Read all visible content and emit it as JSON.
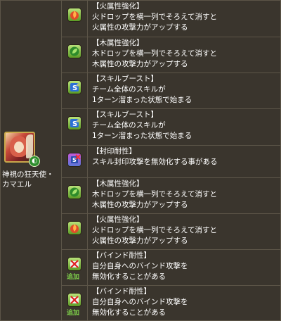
{
  "character": {
    "name_line1": "神視の狂天使・",
    "name_line2": "カマエル",
    "attribute_badge": "wood-attribute-icon"
  },
  "awakenings": [
    {
      "icon": "fire-enhance-icon",
      "title": "【火属性強化】",
      "lines": [
        "火ドロップを横一列でそろえて消すと",
        "火属性の攻撃力がアップする"
      ],
      "added": ""
    },
    {
      "icon": "wood-enhance-icon",
      "title": "【木属性強化】",
      "lines": [
        "木ドロップを横一列でそろえて消すと",
        "木属性の攻撃力がアップする"
      ],
      "added": ""
    },
    {
      "icon": "skill-boost-icon",
      "title": "【スキルブースト】",
      "lines": [
        "チーム全体のスキルが",
        "1ターン溜まった状態で始まる"
      ],
      "added": ""
    },
    {
      "icon": "skill-boost-icon",
      "title": "【スキルブースト】",
      "lines": [
        "チーム全体のスキルが",
        "1ターン溜まった状態で始まる"
      ],
      "added": ""
    },
    {
      "icon": "seal-resist-icon",
      "title": "【封印耐性】",
      "lines": [
        "スキル封印攻撃を無効化する事がある"
      ],
      "added": ""
    },
    {
      "icon": "wood-enhance-icon",
      "title": "【木属性強化】",
      "lines": [
        "木ドロップを横一列でそろえて消すと",
        "木属性の攻撃力がアップする"
      ],
      "added": ""
    },
    {
      "icon": "fire-enhance-icon",
      "title": "【火属性強化】",
      "lines": [
        "火ドロップを横一列でそろえて消すと",
        "火属性の攻撃力がアップする"
      ],
      "added": ""
    },
    {
      "icon": "bind-resist-icon",
      "title": "【バインド耐性】",
      "lines": [
        "自分自身へのバインド攻撃を",
        "無効化することがある"
      ],
      "added": "追加"
    },
    {
      "icon": "bind-resist-icon",
      "title": "【バインド耐性】",
      "lines": [
        "自分自身へのバインド攻撃を",
        "無効化することがある"
      ],
      "added": "追加"
    }
  ]
}
